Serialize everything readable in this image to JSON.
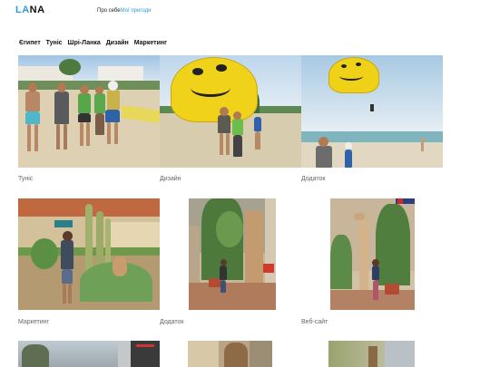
{
  "header": {
    "logo_part1": "LA",
    "logo_part2": "NA",
    "nav": [
      {
        "label": "Про себе"
      },
      {
        "label": "Мої пригоди"
      }
    ]
  },
  "categories": [
    "Єгипет",
    "Туніс",
    "Шрі-Ланка",
    "Дизайн",
    "Маркетинг"
  ],
  "gallery": [
    {
      "caption": "Туніс",
      "photo": "beach-group-photo"
    },
    {
      "caption": "Дизайн",
      "photo": "parasail-smiley-photo"
    },
    {
      "caption": "Додаток",
      "photo": "parasail-sea-photo"
    },
    {
      "caption": "Маркетинг",
      "photo": "cactus-garden-photo"
    },
    {
      "caption": "Додаток",
      "photo": "giraffe-statue-photo"
    },
    {
      "caption": "Веб-сайт",
      "photo": "giraffe-hotel-photo"
    }
  ],
  "colors": {
    "accent": "#2f9bd6",
    "caption": "#666666"
  }
}
